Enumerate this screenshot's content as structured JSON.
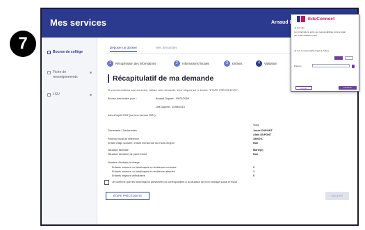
{
  "step_badge": "7",
  "header": {
    "app_title": "Mes services",
    "user_name": "Arnaud D.",
    "user_name_ghost": ""
  },
  "sidebar": {
    "items": [
      {
        "label": "Bourse de collège",
        "active": true
      },
      {
        "label": "Fiche de renseignements",
        "active": false
      },
      {
        "label": "LSU",
        "active": false
      }
    ]
  },
  "tabs": [
    "Déposer un dossier",
    "Mes demandes"
  ],
  "stepper": [
    {
      "num": "1",
      "label": "Récupération des informations"
    },
    {
      "num": "2",
      "label": "Informations fiscales"
    },
    {
      "num": "3",
      "label": "Enfants"
    },
    {
      "num": "4",
      "label": "Validation"
    }
  ],
  "main": {
    "title": "Récapitulatif de ma demande",
    "intro": "Si vos informations sont correctes, validez votre demande, sinon cliquez sur le bouton \"ETAPE PRÉCÉDENTE\".",
    "bourse_label": "Bourse demandée pour :",
    "bourse_values": [
      "Arnaud Dupont - 09/01/2009",
      "Léa Dupont - 11/08/2013"
    ],
    "avis": "Avis d'impôt 2022 (sur les revenus 2021)",
    "col_header": "Vous",
    "declarants_label": "Déclarante / Déclarantes",
    "declarants_values": [
      "Josée DUPONT",
      "Alain DUPONT"
    ],
    "rows": [
      {
        "label": "Revenu fiscal de référence",
        "value": "15000 €"
      },
      {
        "label": "Enfant d'âge scolaire, enfant mentionné sur l'avis d'impôt",
        "value": "Non"
      },
      {
        "label": "Situation familiale",
        "value": "Marié(e)"
      },
      {
        "label": "Situation déclarée de parent isolé",
        "value": "Non"
      }
    ],
    "children_label": "Nombre d'enfants à charge :",
    "children_rows": [
      {
        "label": "Enfants mineurs ou handicapés en résidence exclusive",
        "value": "2"
      },
      {
        "label": "Enfants mineurs ou handicapés en résidence alternée",
        "value": "1"
      },
      {
        "label": "Enfants majeurs célibataires",
        "value": "0"
      }
    ],
    "confirm": "Je confirme que les informations présentées ici correspondent à la situation de mon ménage social et fiscal",
    "prev_button": "ÉTAPE PRÉCÉDENTE",
    "validate_button": "VALIDER"
  },
  "popup": {
    "brand": "EduConnect",
    "lines": [
      "Je suis allé",
      "Les informations entre ces responsabilités comme légal",
      "par l'intermédiaire enfant",
      "Je suis le responsable légal de l'élève"
    ],
    "field_label": "Prénom",
    "cancel": "Annuler",
    "confirm": "Confirmer",
    "colors": {
      "brand": "#c2185b",
      "accent": "#6a3fa0"
    }
  }
}
